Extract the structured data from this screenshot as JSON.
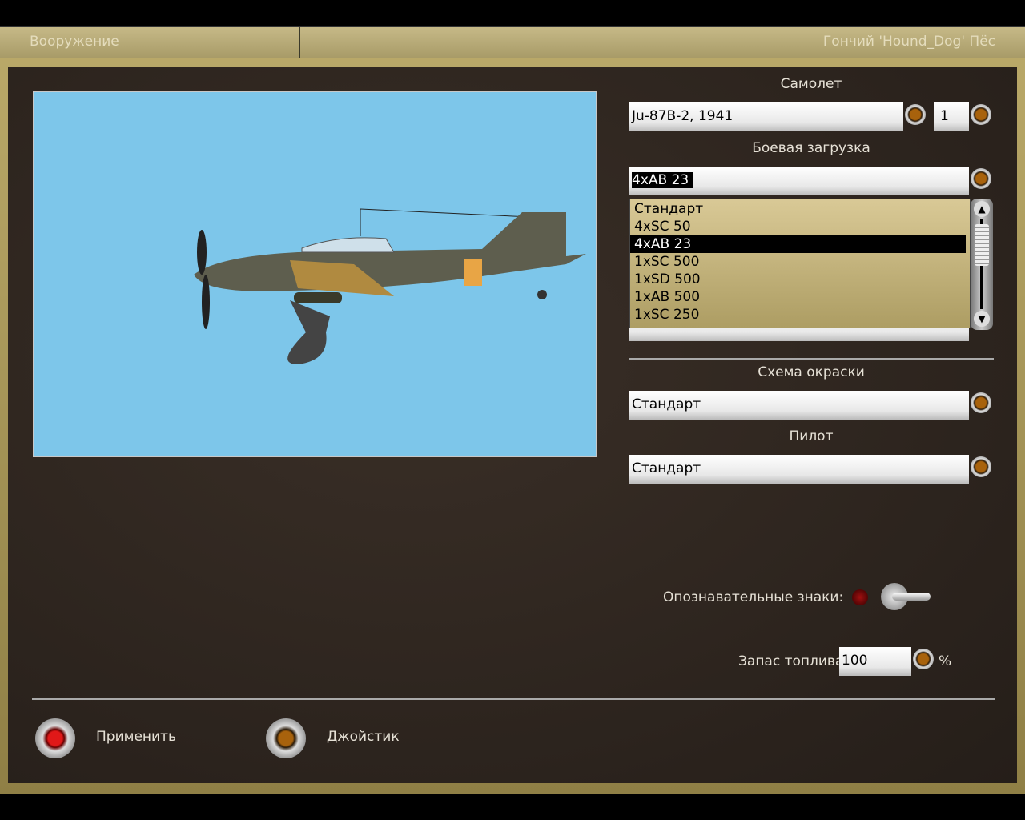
{
  "header": {
    "title": "Вооружение",
    "pilot": "Гончий 'Hound_Dog' Пёс"
  },
  "aircraft": {
    "label": "Самолет",
    "value": "Ju-87B-2, 1941",
    "number": "1"
  },
  "loadout": {
    "label": "Боевая загрузка",
    "value": "4xAB 23",
    "options": [
      "Стандарт",
      "4xSC 50",
      "4xAB 23",
      "1xSC 500",
      "1xSD 500",
      "1xAB 500",
      "1xSC 250"
    ],
    "selected_index": 2
  },
  "skin": {
    "label": "Схема окраски",
    "value": "Стандарт"
  },
  "pilot": {
    "label": "Пилот",
    "value": "Стандарт"
  },
  "markings": {
    "label": "Опознавательные знаки:"
  },
  "fuel": {
    "label": "Запас топлива",
    "value": "100",
    "unit": "%"
  },
  "buttons": {
    "apply": "Применить",
    "joystick": "Джойстик"
  }
}
